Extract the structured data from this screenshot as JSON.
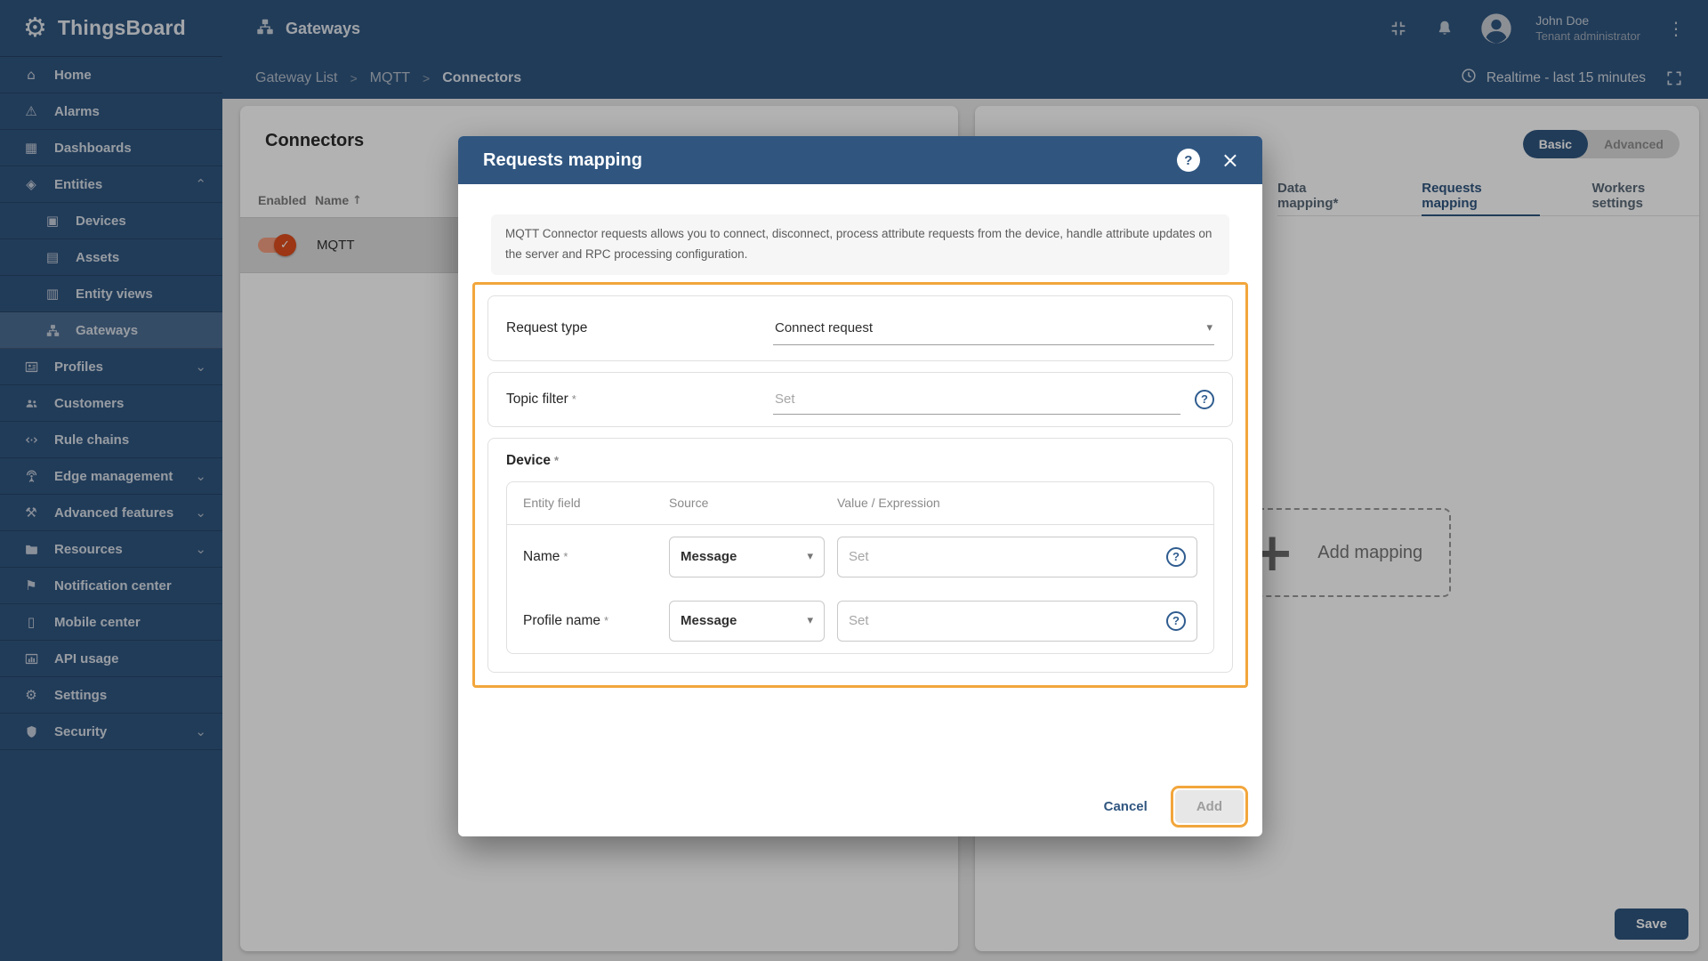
{
  "brand": {
    "name": "ThingsBoard",
    "logo_icon": "thingsboard-gear-logo",
    "logo_glyph": "⚙"
  },
  "topbar": {
    "title": "Gateways",
    "title_icon": "gateways-icon",
    "icons": [
      "collapse-icon",
      "notifications-bell-icon",
      "avatar",
      "more-vert-icon"
    ],
    "user": {
      "name": "John Doe",
      "role": "Tenant administrator"
    }
  },
  "breadcrumb": {
    "items": [
      "Gateway List",
      "MQTT",
      "Connectors"
    ]
  },
  "timewindow": {
    "label": "Realtime - last 15 minutes",
    "clock_icon": "clock-icon",
    "expand_icon": "fullscreen-icon"
  },
  "ui": {
    "breadcrumb_separator": ">",
    "required_marker": "*",
    "dropdown_caret": "▾",
    "close_glyph": "×",
    "help_glyph": "?",
    "plus_glyph": "+",
    "check_glyph": "✓",
    "more_vert_glyph": "⋮",
    "chevron_up": "⌃",
    "chevron_down": "⌄"
  },
  "colors": {
    "primary": "#305680",
    "highlight_orange": "#F2A63C",
    "toggle_on_thumb": "#E04E1D",
    "toggle_on_track": "#F4A081"
  },
  "sidebar": {
    "items": [
      {
        "label": "Home",
        "icon": "home-icon",
        "glyph": "⌂"
      },
      {
        "label": "Alarms",
        "icon": "alarms-icon",
        "glyph": "⚠"
      },
      {
        "label": "Dashboards",
        "icon": "dashboards-icon",
        "glyph": "▦"
      },
      {
        "label": "Entities",
        "icon": "entities-icon",
        "glyph": "◈",
        "expanded": true
      },
      {
        "label": "Devices",
        "icon": "devices-icon",
        "glyph": "▣"
      },
      {
        "label": "Assets",
        "icon": "assets-icon",
        "glyph": "▤"
      },
      {
        "label": "Entity views",
        "icon": "entity-views-icon",
        "glyph": "▥"
      },
      {
        "label": "Gateways",
        "icon": "gateways-icon",
        "active": true
      },
      {
        "label": "Profiles",
        "icon": "profiles-icon"
      },
      {
        "label": "Customers",
        "icon": "customers-icon"
      },
      {
        "label": "Rule chains",
        "icon": "rule-chains-icon"
      },
      {
        "label": "Edge management",
        "icon": "edge-management-icon"
      },
      {
        "label": "Advanced features",
        "icon": "advanced-features-icon",
        "glyph": "⚒"
      },
      {
        "label": "Resources",
        "icon": "resources-icon"
      },
      {
        "label": "Notification center",
        "icon": "notification-center-icon",
        "glyph": "⚑"
      },
      {
        "label": "Mobile center",
        "icon": "mobile-center-icon",
        "glyph": "▯"
      },
      {
        "label": "API usage",
        "icon": "api-usage-icon"
      },
      {
        "label": "Settings",
        "icon": "settings-icon",
        "glyph": "⚙"
      },
      {
        "label": "Security",
        "icon": "security-icon"
      }
    ]
  },
  "connectors_panel": {
    "title": "Connectors",
    "columns": [
      "Enabled",
      "Name"
    ],
    "sort_indicator": "↑",
    "rows": [
      {
        "name": "MQTT",
        "enabled": true
      }
    ]
  },
  "config_panel": {
    "mode_toggle": {
      "options": [
        "Basic",
        "Advanced"
      ],
      "selected": "Basic"
    },
    "tabs": [
      {
        "label": "Data mapping*"
      },
      {
        "label": "Requests mapping",
        "active": true
      },
      {
        "label": "Workers settings"
      }
    ],
    "add_mapping_label": "Add mapping",
    "save_label": "Save"
  },
  "dialog": {
    "title": "Requests mapping",
    "info": "MQTT Connector requests allows you to connect, disconnect, process attribute requests from the device, handle attribute updates on the server and RPC processing configuration.",
    "request_type": {
      "label": "Request type",
      "value": "Connect request"
    },
    "topic_filter": {
      "label": "Topic filter",
      "required": true,
      "placeholder": "Set"
    },
    "device": {
      "label": "Device",
      "required": true,
      "columns": [
        "Entity field",
        "Source",
        "Value / Expression"
      ],
      "rows": [
        {
          "field": "Name",
          "required": true,
          "source": "Message",
          "placeholder": "Set"
        },
        {
          "field": "Profile name",
          "required": true,
          "source": "Message",
          "placeholder": "Set"
        }
      ]
    },
    "footer": {
      "cancel_label": "Cancel",
      "add_label": "Add"
    }
  }
}
